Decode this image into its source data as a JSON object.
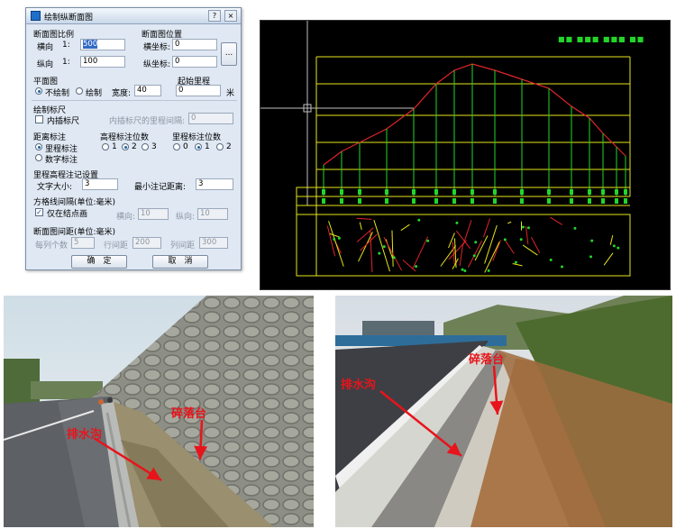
{
  "dialog": {
    "title": "绘制纵断面图",
    "title_buttons": [
      "?",
      "×"
    ],
    "section_scale": {
      "heading": "断面图比例",
      "horizontal_label": "横向",
      "horizontal_prefix": "1:",
      "horizontal_value": "500",
      "vertical_label": "纵向",
      "vertical_prefix": "1:",
      "vertical_value": "100"
    },
    "section_position": {
      "heading": "断面图位置",
      "x_label": "横坐标:",
      "x_value": "0",
      "y_label": "纵坐标:",
      "y_value": "0",
      "pick_button": "..."
    },
    "plan": {
      "heading": "平面图",
      "option_no_draw": "不绘制",
      "option_draw": "绘制",
      "width_label": "宽度:",
      "width_value": "40"
    },
    "start_mileage": {
      "heading": "起始里程",
      "value": "0",
      "unit": "米"
    },
    "ruler": {
      "heading": "绘制标尺",
      "inner_ruler_label": "内插标尺",
      "inner_interval_label": "内插标尺的里程间隔:",
      "inner_interval_value": "0"
    },
    "distance_label": {
      "heading": "距离标注",
      "option_mileage": "里程标注",
      "option_number": "数字标注"
    },
    "elevation_digits": {
      "heading": "高程标注位数",
      "options": [
        "1",
        "2",
        "3"
      ]
    },
    "mileage_digits": {
      "heading": "里程标注位数",
      "options": [
        "0",
        "1",
        "2"
      ]
    },
    "annotation": {
      "heading": "里程高程注记设置",
      "font_size_label": "文字大小:",
      "font_size_value": "3",
      "min_distance_label": "最小注记距离:",
      "min_distance_value": "3"
    },
    "grid": {
      "heading": "方格线间隔(单位:毫米)",
      "only_nodes_label": "仅在结点画",
      "horizontal_label": "横向:",
      "horizontal_value": "10",
      "vertical_label": "纵向:",
      "vertical_value": "10"
    },
    "spacing": {
      "heading": "断面图间距(单位:毫米)",
      "per_column_label": "每列个数",
      "per_column_value": "5",
      "row_spacing_label": "行间距",
      "row_spacing_value": "200",
      "col_spacing_label": "列间距",
      "col_spacing_value": "300"
    },
    "ok_button": "确　定",
    "cancel_button": "取　消"
  },
  "cad_view": {
    "legend_text": "■■ ■■■ ■■■ ■■",
    "colors": {
      "background": "#000000",
      "profile": "#e0242a",
      "grid": "#e6e61a",
      "stations": "#22d62a",
      "crosshair": "#bfbfbf"
    }
  },
  "photo_left": {
    "label_drain": "排水沟",
    "label_platform": "碎落台"
  },
  "photo_right": {
    "label_drain": "排水沟",
    "label_platform": "碎落台"
  },
  "colors": {
    "label_red": "#e8141b",
    "dialog_bg": "#dfe8f3"
  }
}
